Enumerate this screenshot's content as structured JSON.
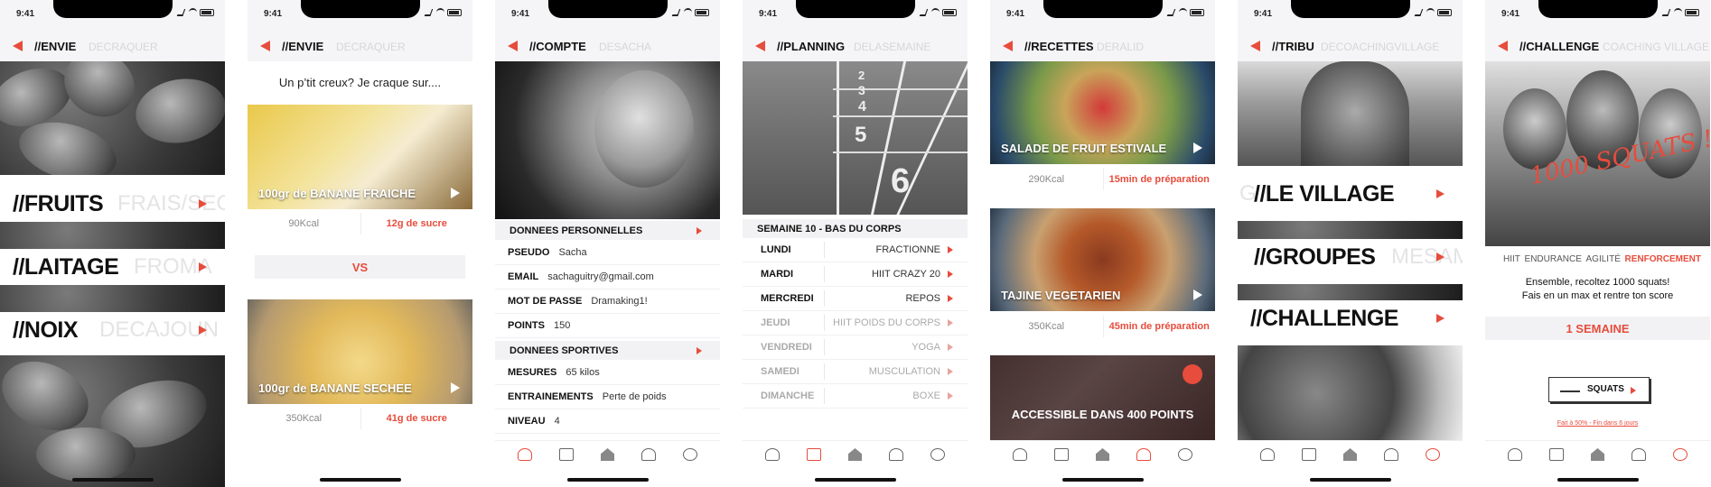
{
  "status_time": "9:41",
  "envie1": {
    "title": "//ENVIE",
    "ghost": "DECRAQUER",
    "categories": [
      {
        "title": "//FRUITS",
        "ghost": "FRAIS/SEC"
      },
      {
        "title": "//LAITAGE",
        "ghost": "FROMA"
      },
      {
        "title": "//NOIX",
        "ghost": "DECAJOUN"
      }
    ]
  },
  "envie2": {
    "title": "//ENVIE",
    "ghost": "DECRAQUER",
    "prompt": "Un p’tit creux? Je craque sur....",
    "item1": {
      "title": "100gr de BANANE FRAICHE",
      "kcal": "90Kcal",
      "sugar": "12g de sucre"
    },
    "vs": "VS",
    "item2": {
      "title": "100gr de BANANE SECHEE",
      "kcal": "350Kcal",
      "sugar": "41g de sucre"
    }
  },
  "compte": {
    "title": "//COMPTE",
    "ghost": "DESACHA",
    "section1": "DONNEES PERSONNELLES",
    "fields1": [
      {
        "label": "PSEUDO",
        "value": "Sacha"
      },
      {
        "label": "EMAIL",
        "value": "sachaguitry@gmail.com"
      },
      {
        "label": "MOT DE PASSE",
        "value": "Dramaking1!"
      },
      {
        "label": "POINTS",
        "value": "150"
      }
    ],
    "section2": "Donnees sportives",
    "fields2": [
      {
        "label": "MESURES",
        "value": "65 kilos"
      },
      {
        "label": "ENTRAINEMENTS",
        "value": "Perte de poids"
      },
      {
        "label": "NIVEAU",
        "value": "4"
      }
    ]
  },
  "planning": {
    "title": "//PLANNING",
    "ghost": "DELASEMAINE",
    "lane_numbers": [
      "2",
      "3",
      "4",
      "5",
      "6"
    ],
    "week": "SEMAINE 10 - BAS DU CORPS",
    "days": [
      {
        "day": "LUNDI",
        "activity": "FRACTIONNE"
      },
      {
        "day": "MARDI",
        "activity": "HIIT CRAZY 20"
      },
      {
        "day": "MERCREDI",
        "activity": "REPOS"
      },
      {
        "day": "JEUDI",
        "activity": "HIIT POIDS DU CORPS"
      },
      {
        "day": "VENDREDI",
        "activity": "YOGA"
      },
      {
        "day": "SAMEDI",
        "activity": "MUSCULATION"
      },
      {
        "day": "DIMANCHE",
        "activity": "BOXE"
      }
    ]
  },
  "recettes": {
    "title": "//RECETTES",
    "ghost": "DERALID",
    "recipes": [
      {
        "title": "SALADE DE FRUIT ESTIVALE",
        "kcal": "290Kcal",
        "prep": "15min de préparation"
      },
      {
        "title": "TAJINE VEGETARIEN",
        "kcal": "350Kcal",
        "prep": "45min de préparation"
      }
    ],
    "locked": "ACCESSIBLE DANS 400 POINTS"
  },
  "tribu": {
    "title": "//TRIBU",
    "ghost": "DECOACHINGVILLAGE",
    "items": [
      {
        "title": "//LE VILLAGE",
        "ghost": "G"
      },
      {
        "title": "//GROUPES",
        "ghost": "MESAM"
      },
      {
        "title": "//CHALLENGE",
        "ghost": ""
      }
    ]
  },
  "challenge": {
    "title": "//CHALLENGE",
    "ghost": "COACHING VILLAGE",
    "banner_text": "1000 SQUATS !",
    "tabs": [
      "HIIT",
      "ENDURANCE",
      "AGILITÉ",
      "RENFORCEMENT"
    ],
    "desc1": "Ensemble, recoltez 1000 squats!",
    "desc2": "Fais en un max et rentre ton score",
    "duration": "1 SEMAINE",
    "button": "SQUATS",
    "progress": "Fait à 50% - Fin dans 6 jours"
  },
  "colors": {
    "accent": "#e74c3c",
    "header_bg": "#f5f5f7"
  }
}
